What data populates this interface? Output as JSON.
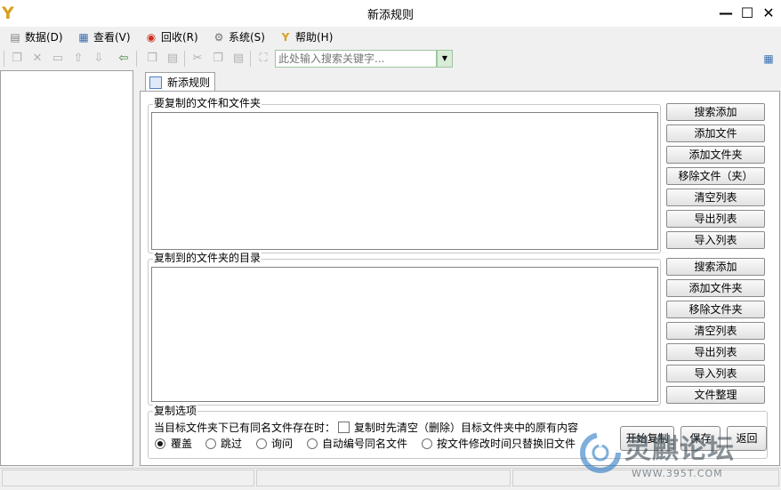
{
  "window": {
    "title": "新添规则"
  },
  "menu": [
    {
      "label": "数据(D)",
      "icon": "database-icon"
    },
    {
      "label": "查看(V)",
      "icon": "view-icon"
    },
    {
      "label": "回收(R)",
      "icon": "lifebuoy-icon"
    },
    {
      "label": "系统(S)",
      "icon": "gear-icon"
    },
    {
      "label": "帮助(H)",
      "icon": "help-icon"
    }
  ],
  "toolbar": {
    "search_placeholder": "此处输入搜索关键字..."
  },
  "tab": {
    "label": "新添规则"
  },
  "source_group": {
    "label": "要复制的文件和文件夹",
    "buttons": [
      "搜索添加",
      "添加文件",
      "添加文件夹",
      "移除文件（夹）",
      "清空列表",
      "导出列表",
      "导入列表"
    ]
  },
  "dest_group": {
    "label": "复制到的文件夹的目录",
    "buttons": [
      "搜索添加",
      "添加文件夹",
      "移除文件夹",
      "清空列表",
      "导出列表",
      "导入列表",
      "文件整理"
    ]
  },
  "options": {
    "label": "复制选项",
    "conflict_text": "当目标文件夹下已有同名文件存在时：",
    "clear_first_label": "复制时先清空（删除）目标文件夹中的原有内容",
    "clear_first_checked": false,
    "radios": [
      "覆盖",
      "跳过",
      "询问",
      "自动编号同名文件",
      "按文件修改时间只替换旧文件"
    ],
    "selected": "覆盖"
  },
  "actions": {
    "start": "开始复制",
    "save": "保存",
    "back": "返回"
  },
  "watermark": {
    "name": "灵麒论坛",
    "url": "WWW.395T.COM"
  },
  "colors": {
    "accent": "#2b7bc4",
    "search_border": "#9fc59f"
  }
}
